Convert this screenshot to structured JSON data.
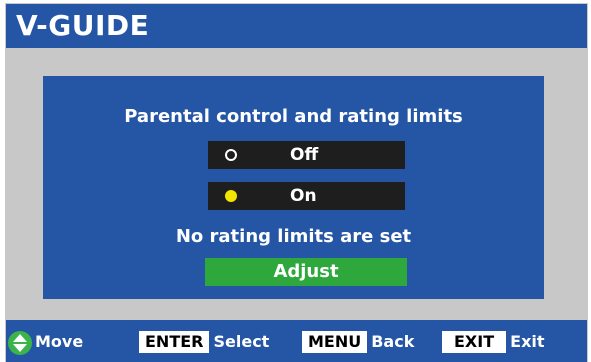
{
  "header": {
    "title": "V-GUIDE"
  },
  "dialog": {
    "title": "Parental control and rating limits",
    "options": [
      {
        "label": "Off",
        "selected": false
      },
      {
        "label": "On",
        "selected": true
      }
    ],
    "status_text": "No rating limits are set",
    "adjust_label": "Adjust"
  },
  "footer": {
    "move_label": "Move",
    "enter_key": "ENTER",
    "enter_label": "Select",
    "menu_key": "MENU",
    "menu_label": "Back",
    "exit_key": "EXIT",
    "exit_label": "Exit"
  },
  "colors": {
    "header_blue": "#2456a5",
    "body_gray": "#c8c8c8",
    "option_bg": "#1e1e1e",
    "selected_radio": "#f2e500",
    "adjust_green": "#2ea83c",
    "move_icon_green": "#3bb54a"
  },
  "icons": {
    "move": "up-down-arrows-icon"
  }
}
